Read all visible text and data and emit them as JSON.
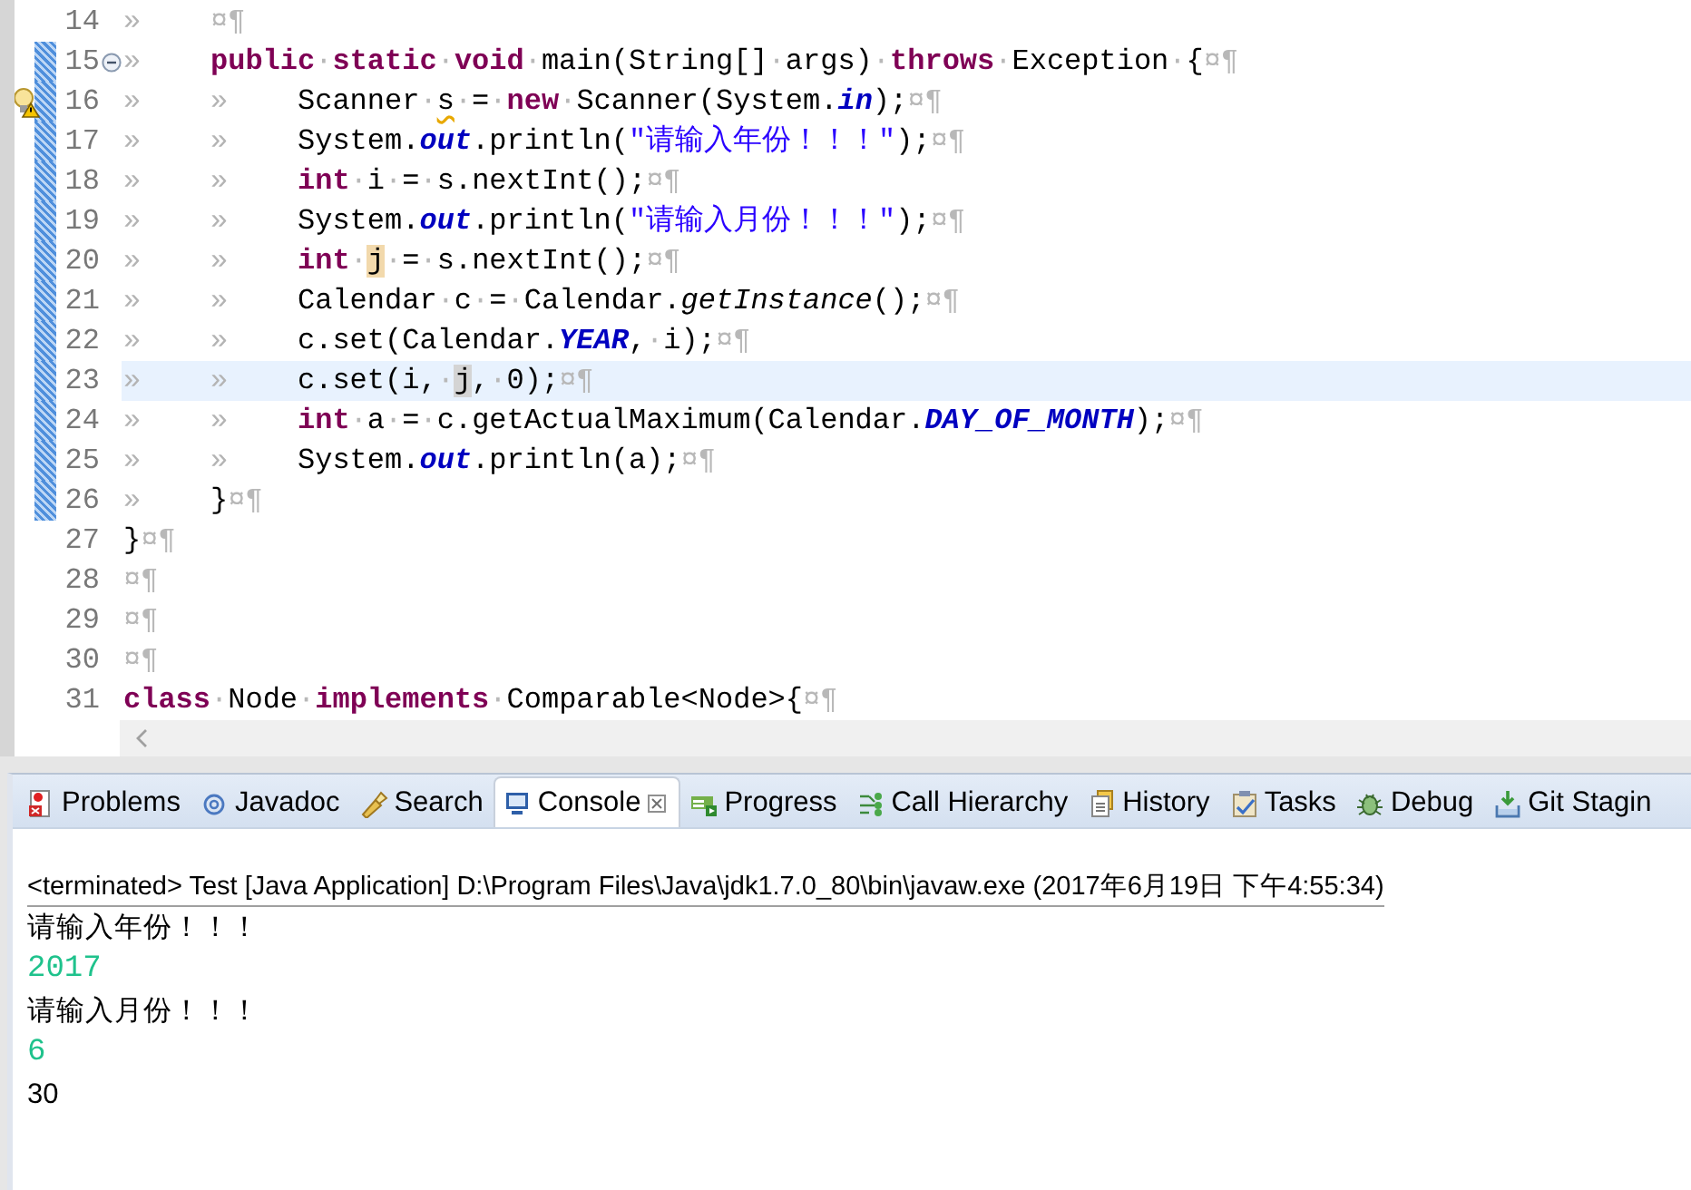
{
  "editor": {
    "lines": [
      {
        "number": "14",
        "kind": "code",
        "changed": false,
        "current": false,
        "tokens": [
          {
            "kind": "tab",
            "text": "»"
          },
          {
            "kind": "eol",
            "text": "¤¶"
          }
        ]
      },
      {
        "number": "15",
        "kind": "fold",
        "changed": true,
        "current": false,
        "tokens": [
          {
            "kind": "tab",
            "text": "»"
          },
          {
            "kind": "kw",
            "text": "public"
          },
          {
            "kind": "sp",
            "text": "·"
          },
          {
            "kind": "kw",
            "text": "static"
          },
          {
            "kind": "sp",
            "text": "·"
          },
          {
            "kind": "kw",
            "text": "void"
          },
          {
            "kind": "sp",
            "text": "·"
          },
          {
            "kind": "plain",
            "text": "main(String[]"
          },
          {
            "kind": "sp",
            "text": "·"
          },
          {
            "kind": "plain",
            "text": "args)"
          },
          {
            "kind": "sp",
            "text": "·"
          },
          {
            "kind": "kw",
            "text": "throws"
          },
          {
            "kind": "sp",
            "text": "·"
          },
          {
            "kind": "plain",
            "text": "Exception"
          },
          {
            "kind": "sp",
            "text": "·"
          },
          {
            "kind": "plain",
            "text": "{"
          },
          {
            "kind": "eol",
            "text": "¤¶"
          }
        ]
      },
      {
        "number": "16",
        "kind": "warning",
        "changed": true,
        "current": false,
        "tokens": [
          {
            "kind": "tab",
            "text": "»"
          },
          {
            "kind": "tab",
            "text": "»"
          },
          {
            "kind": "plain",
            "text": "Scanner"
          },
          {
            "kind": "sp",
            "text": "·"
          },
          {
            "kind": "warn",
            "text": "s"
          },
          {
            "kind": "sp",
            "text": "·"
          },
          {
            "kind": "plain",
            "text": "="
          },
          {
            "kind": "sp",
            "text": "·"
          },
          {
            "kind": "kw",
            "text": "new"
          },
          {
            "kind": "sp",
            "text": "·"
          },
          {
            "kind": "plain",
            "text": "Scanner(System."
          },
          {
            "kind": "field",
            "text": "in"
          },
          {
            "kind": "plain",
            "text": ");"
          },
          {
            "kind": "eol",
            "text": "¤¶"
          }
        ]
      },
      {
        "number": "17",
        "kind": "code",
        "changed": true,
        "current": false,
        "tokens": [
          {
            "kind": "tab",
            "text": "»"
          },
          {
            "kind": "tab",
            "text": "»"
          },
          {
            "kind": "plain",
            "text": "System."
          },
          {
            "kind": "field",
            "text": "out"
          },
          {
            "kind": "plain",
            "text": ".println("
          },
          {
            "kind": "str",
            "text": "\"请输入年份！！！\""
          },
          {
            "kind": "plain",
            "text": ");"
          },
          {
            "kind": "eol",
            "text": "¤¶"
          }
        ]
      },
      {
        "number": "18",
        "kind": "code",
        "changed": true,
        "current": false,
        "tokens": [
          {
            "kind": "tab",
            "text": "»"
          },
          {
            "kind": "tab",
            "text": "»"
          },
          {
            "kind": "kw",
            "text": "int"
          },
          {
            "kind": "sp",
            "text": "·"
          },
          {
            "kind": "plain",
            "text": "i"
          },
          {
            "kind": "sp",
            "text": "·"
          },
          {
            "kind": "plain",
            "text": "="
          },
          {
            "kind": "sp",
            "text": "·"
          },
          {
            "kind": "plain",
            "text": "s.nextInt();"
          },
          {
            "kind": "eol",
            "text": "¤¶"
          }
        ]
      },
      {
        "number": "19",
        "kind": "code",
        "changed": true,
        "current": false,
        "tokens": [
          {
            "kind": "tab",
            "text": "»"
          },
          {
            "kind": "tab",
            "text": "»"
          },
          {
            "kind": "plain",
            "text": "System."
          },
          {
            "kind": "field",
            "text": "out"
          },
          {
            "kind": "plain",
            "text": ".println("
          },
          {
            "kind": "str",
            "text": "\"请输入月份！！！\""
          },
          {
            "kind": "plain",
            "text": ");"
          },
          {
            "kind": "eol",
            "text": "¤¶"
          }
        ]
      },
      {
        "number": "20",
        "kind": "code",
        "changed": true,
        "current": false,
        "tokens": [
          {
            "kind": "tab",
            "text": "»"
          },
          {
            "kind": "tab",
            "text": "»"
          },
          {
            "kind": "kw",
            "text": "int"
          },
          {
            "kind": "sp",
            "text": "·"
          },
          {
            "kind": "occ-write",
            "text": "j"
          },
          {
            "kind": "sp",
            "text": "·"
          },
          {
            "kind": "plain",
            "text": "="
          },
          {
            "kind": "sp",
            "text": "·"
          },
          {
            "kind": "plain",
            "text": "s.nextInt();"
          },
          {
            "kind": "eol",
            "text": "¤¶"
          }
        ]
      },
      {
        "number": "21",
        "kind": "code",
        "changed": true,
        "current": false,
        "tokens": [
          {
            "kind": "tab",
            "text": "»"
          },
          {
            "kind": "tab",
            "text": "»"
          },
          {
            "kind": "plain",
            "text": "Calendar"
          },
          {
            "kind": "sp",
            "text": "·"
          },
          {
            "kind": "plain",
            "text": "c"
          },
          {
            "kind": "sp",
            "text": "·"
          },
          {
            "kind": "plain",
            "text": "="
          },
          {
            "kind": "sp",
            "text": "·"
          },
          {
            "kind": "plain",
            "text": "Calendar."
          },
          {
            "kind": "method",
            "text": "getInstance"
          },
          {
            "kind": "plain",
            "text": "();"
          },
          {
            "kind": "eol",
            "text": "¤¶"
          }
        ]
      },
      {
        "number": "22",
        "kind": "code",
        "changed": true,
        "current": false,
        "tokens": [
          {
            "kind": "tab",
            "text": "»"
          },
          {
            "kind": "tab",
            "text": "»"
          },
          {
            "kind": "plain",
            "text": "c.set(Calendar."
          },
          {
            "kind": "field",
            "text": "YEAR"
          },
          {
            "kind": "plain",
            "text": ","
          },
          {
            "kind": "sp",
            "text": "·"
          },
          {
            "kind": "plain",
            "text": "i);"
          },
          {
            "kind": "eol",
            "text": "¤¶"
          }
        ]
      },
      {
        "number": "23",
        "kind": "code",
        "changed": true,
        "current": true,
        "tokens": [
          {
            "kind": "tab",
            "text": "»"
          },
          {
            "kind": "tab",
            "text": "»"
          },
          {
            "kind": "plain",
            "text": "c.set(i,"
          },
          {
            "kind": "sp",
            "text": "·"
          },
          {
            "kind": "occ-read",
            "text": "j"
          },
          {
            "kind": "plain",
            "text": ","
          },
          {
            "kind": "sp",
            "text": "·"
          },
          {
            "kind": "plain",
            "text": "0);"
          },
          {
            "kind": "eol",
            "text": "¤¶"
          }
        ]
      },
      {
        "number": "24",
        "kind": "code",
        "changed": true,
        "current": false,
        "tokens": [
          {
            "kind": "tab",
            "text": "»"
          },
          {
            "kind": "tab",
            "text": "»"
          },
          {
            "kind": "kw",
            "text": "int"
          },
          {
            "kind": "sp",
            "text": "·"
          },
          {
            "kind": "plain",
            "text": "a"
          },
          {
            "kind": "sp",
            "text": "·"
          },
          {
            "kind": "plain",
            "text": "="
          },
          {
            "kind": "sp",
            "text": "·"
          },
          {
            "kind": "plain",
            "text": "c.getActualMaximum(Calendar."
          },
          {
            "kind": "field",
            "text": "DAY_OF_MONTH"
          },
          {
            "kind": "plain",
            "text": ");"
          },
          {
            "kind": "eol",
            "text": "¤¶"
          }
        ]
      },
      {
        "number": "25",
        "kind": "code",
        "changed": true,
        "current": false,
        "tokens": [
          {
            "kind": "tab",
            "text": "»"
          },
          {
            "kind": "tab",
            "text": "»"
          },
          {
            "kind": "plain",
            "text": "System."
          },
          {
            "kind": "field",
            "text": "out"
          },
          {
            "kind": "plain",
            "text": ".println(a);"
          },
          {
            "kind": "eol",
            "text": "¤¶"
          }
        ]
      },
      {
        "number": "26",
        "kind": "code",
        "changed": true,
        "current": false,
        "tokens": [
          {
            "kind": "tab",
            "text": "»"
          },
          {
            "kind": "plain",
            "text": "}"
          },
          {
            "kind": "eol",
            "text": "¤¶"
          }
        ]
      },
      {
        "number": "27",
        "kind": "code",
        "changed": false,
        "current": false,
        "tokens": [
          {
            "kind": "plain",
            "text": "}"
          },
          {
            "kind": "eol",
            "text": "¤¶"
          }
        ]
      },
      {
        "number": "28",
        "kind": "code",
        "changed": false,
        "current": false,
        "tokens": [
          {
            "kind": "eol",
            "text": "¤¶"
          }
        ]
      },
      {
        "number": "29",
        "kind": "code",
        "changed": false,
        "current": false,
        "tokens": [
          {
            "kind": "eol",
            "text": "¤¶"
          }
        ]
      },
      {
        "number": "30",
        "kind": "code",
        "changed": false,
        "current": false,
        "tokens": [
          {
            "kind": "eol",
            "text": "¤¶"
          }
        ]
      },
      {
        "number": "31",
        "kind": "code",
        "changed": false,
        "current": false,
        "tokens": [
          {
            "kind": "kw",
            "text": "class"
          },
          {
            "kind": "sp",
            "text": "·"
          },
          {
            "kind": "plain",
            "text": "Node"
          },
          {
            "kind": "sp",
            "text": "·"
          },
          {
            "kind": "kw",
            "text": "implements"
          },
          {
            "kind": "sp",
            "text": "·"
          },
          {
            "kind": "plain",
            "text": "Comparable<Node>{"
          },
          {
            "kind": "eol",
            "text": "¤¶"
          }
        ]
      }
    ]
  },
  "tabs": [
    {
      "label": "Problems",
      "selected": false
    },
    {
      "label": "Javadoc",
      "selected": false
    },
    {
      "label": "Search",
      "selected": false
    },
    {
      "label": "Console",
      "selected": true
    },
    {
      "label": "Progress",
      "selected": false
    },
    {
      "label": "Call Hierarchy",
      "selected": false
    },
    {
      "label": "History",
      "selected": false
    },
    {
      "label": "Tasks",
      "selected": false
    },
    {
      "label": "Debug",
      "selected": false
    },
    {
      "label": "Git Stagin",
      "selected": false
    }
  ],
  "console": {
    "header": "<terminated> Test [Java Application] D:\\Program Files\\Java\\jdk1.7.0_80\\bin\\javaw.exe (2017年6月19日 下午4:55:34)",
    "output": [
      {
        "kind": "out",
        "text": "请输入年份！！！"
      },
      {
        "kind": "in",
        "text": "2017"
      },
      {
        "kind": "out",
        "text": "请输入月份！！！"
      },
      {
        "kind": "in",
        "text": "6"
      },
      {
        "kind": "out",
        "text": "30"
      }
    ]
  }
}
